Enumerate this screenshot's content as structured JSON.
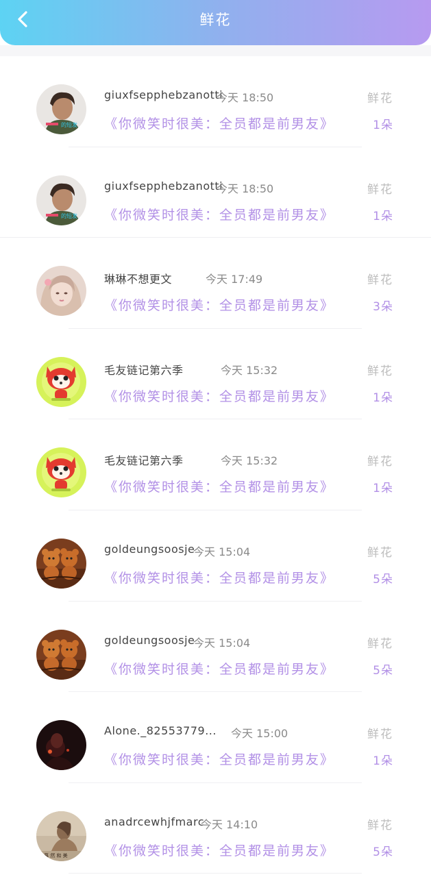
{
  "header": {
    "title": "鲜花",
    "back_icon": "chevron-left-icon",
    "gradient": [
      "#5dd3f3",
      "#b79af0"
    ]
  },
  "colors": {
    "accent": "#b290e6",
    "muted": "#bdbdbd"
  },
  "records": [
    {
      "avatar": "portrait-man",
      "avatar_badge": "的短发",
      "name": "giuxfsepphebzanotti",
      "time": "今天 18:50",
      "gift_title": "《你微笑时很美：全员都是前男友》",
      "gift_name": "鲜花",
      "count": "1朵"
    },
    {
      "avatar": "portrait-man",
      "avatar_badge": "的短发",
      "name": "giuxfsepphebzanotti",
      "time": "今天 18:50",
      "gift_title": "《你微笑时很美：全员都是前男友》",
      "gift_name": "鲜花",
      "count": "1朵"
    },
    {
      "avatar": "portrait-girl",
      "name": "琳琳不想更文",
      "time": "今天 17:49",
      "gift_title": "《你微笑时很美：全员都是前男友》",
      "gift_name": "鲜花",
      "count": "3朵"
    },
    {
      "avatar": "cartoon-fox",
      "name": "毛友链记第六季",
      "time": "今天 15:32",
      "gift_title": "《你微笑时很美：全员都是前男友》",
      "gift_name": "鲜花",
      "count": "1朵"
    },
    {
      "avatar": "cartoon-fox",
      "name": "毛友链记第六季",
      "time": "今天 15:32",
      "gift_title": "《你微笑时很美：全员都是前男友》",
      "gift_name": "鲜花",
      "count": "1朵"
    },
    {
      "avatar": "teddy-bears",
      "name": "goldeungsoosje",
      "time": "今天 15:04",
      "gift_title": "《你微笑时很美：全员都是前男友》",
      "gift_name": "鲜花",
      "count": "5朵"
    },
    {
      "avatar": "teddy-bears",
      "name": "goldeungsoosje",
      "time": "今天 15:04",
      "gift_title": "《你微笑时很美：全员都是前男友》",
      "gift_name": "鲜花",
      "count": "5朵"
    },
    {
      "avatar": "dark-scene",
      "name": "Alone._82553779...",
      "time": "今天 15:00",
      "gift_title": "《你微笑时很美：全员都是前男友》",
      "gift_name": "鲜花",
      "count": "1朵"
    },
    {
      "avatar": "sepia-girl",
      "avatar_badge": "暮 然 和 美",
      "name": "anadrcewhjfmarc",
      "time": "今天 14:10",
      "gift_title": "《你微笑时很美：全员都是前男友》",
      "gift_name": "鲜花",
      "count": "5朵"
    }
  ]
}
